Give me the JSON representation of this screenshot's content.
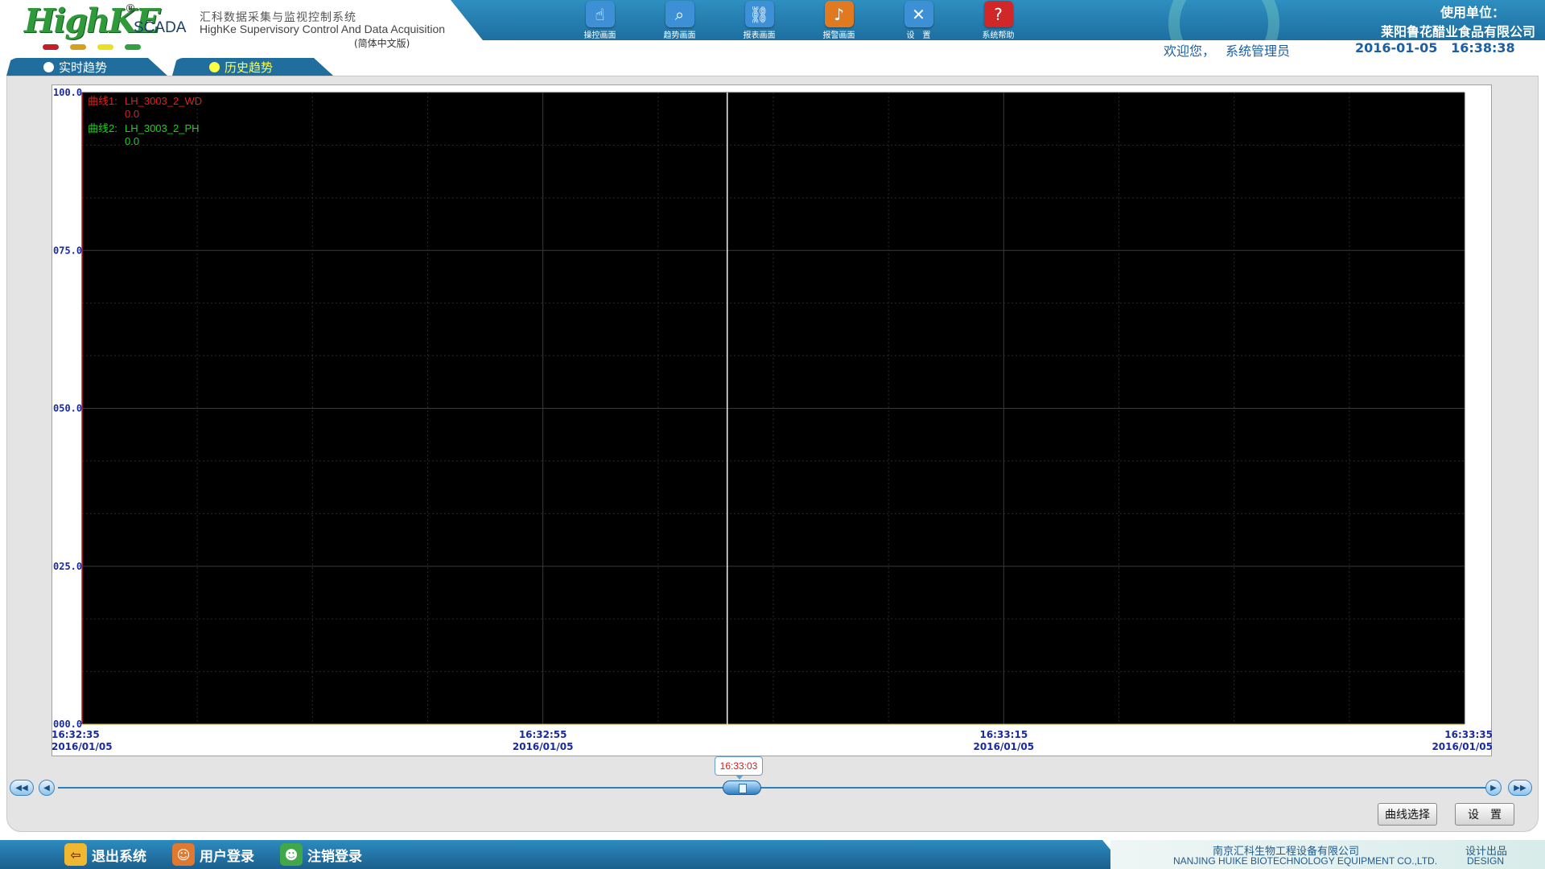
{
  "header": {
    "logo_text": "HighKE",
    "logo_reg": "®",
    "scada": "SCADA",
    "system_cn": "汇科数据采集与监视控制系统",
    "system_en": "HighKe Supervisory Control And Data Acquisition",
    "version": "(简体中文版)",
    "unit_label": "使用单位：",
    "unit_name": "莱阳鲁花醋业食品有限公司",
    "welcome": "欢迎您，",
    "user": "系统管理员",
    "date": "2016-01-05",
    "time": "16:38:38",
    "indicator_colors": [
      "#c0202a",
      "#d4a020",
      "#e8e020",
      "#30a040"
    ]
  },
  "toolbar": [
    {
      "label": "操控画面",
      "icon": "hand-pointer-icon",
      "color": "#3d8fd6"
    },
    {
      "label": "趋势画面",
      "icon": "magnifier-chart-icon",
      "color": "#3d8fd6"
    },
    {
      "label": "报表画面",
      "icon": "report-chain-icon",
      "color": "#3d8fd6"
    },
    {
      "label": "报警画面",
      "icon": "alarm-bell-icon",
      "color": "#e07a20"
    },
    {
      "label": "设　置",
      "icon": "tools-icon",
      "color": "#3d8fd6"
    },
    {
      "label": "系统帮助",
      "icon": "help-icon",
      "color": "#d02828"
    }
  ],
  "tabs": [
    {
      "label": "实时趋势",
      "active": false
    },
    {
      "label": "历史趋势",
      "active": true
    }
  ],
  "chart_data": {
    "type": "line",
    "title": "",
    "xlabel": "",
    "ylabel": "",
    "ylim": [
      0,
      100
    ],
    "yticks": [
      "000.0",
      "025.0",
      "050.0",
      "075.0",
      "100.0"
    ],
    "x_range": [
      "16:32:35",
      "16:33:35"
    ],
    "xticks": [
      {
        "time": "16:32:35",
        "date": "2016/01/05"
      },
      {
        "time": "16:32:55",
        "date": "2016/01/05"
      },
      {
        "time": "16:33:15",
        "date": "2016/01/05"
      },
      {
        "time": "16:33:35",
        "date": "2016/01/05"
      }
    ],
    "cursor_time": "16:33:03",
    "grid": true,
    "background": "#000000",
    "series": [
      {
        "name": "LH_3003_2_WD",
        "tag": "曲线1:",
        "value": "0.0",
        "color": "#e02020",
        "values": []
      },
      {
        "name": "LH_3003_2_PH",
        "tag": "曲线2:",
        "value": "0.0",
        "color": "#20d020",
        "values": []
      }
    ]
  },
  "slider": {
    "cursor_label": "16:33:03",
    "cursor_position": 0.48
  },
  "buttons": {
    "curve_select": "曲线选择",
    "settings": "设　置"
  },
  "footer": {
    "exit": "退出系统",
    "login": "用户登录",
    "logout": "注销登录",
    "company_cn": "南京汇科生物工程设备有限公司",
    "company_en": "NANJING HUIKE BIOTECHNOLOGY EQUIPMENT CO.,LTD.",
    "design_cn": "设计出品",
    "design_en": "DESIGN"
  }
}
